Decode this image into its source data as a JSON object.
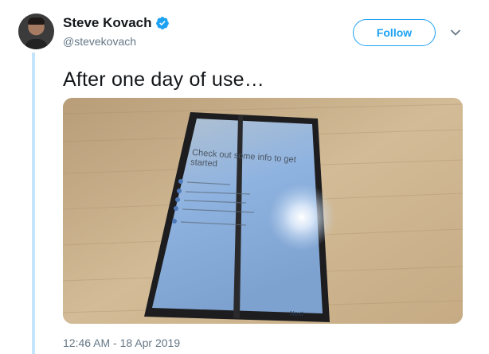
{
  "tweet": {
    "author_name": "Steve Kovach",
    "author_handle": "@stevekovach",
    "follow_label": "Follow",
    "text": "After one day of use…",
    "timestamp": "12:46 AM - 18 Apr 2019",
    "verified_icon": "verified-badge-icon",
    "more_icon": "chevron-down-icon"
  },
  "media": {
    "type": "photo",
    "screen_heading": "Check out some info to get started",
    "screen_next": "Next"
  },
  "colors": {
    "accent": "#1da1f2",
    "thread_line": "#c4e5fb",
    "secondary_text": "#657786"
  }
}
